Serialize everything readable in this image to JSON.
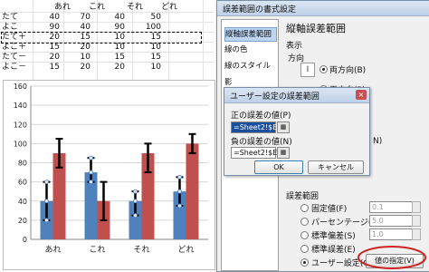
{
  "sheet": {
    "headers": [
      "あれ",
      "これ",
      "それ",
      "どれ"
    ],
    "rows": [
      {
        "label": "たて",
        "values": [
          "40",
          "70",
          "40",
          "50"
        ]
      },
      {
        "label": "よこ",
        "values": [
          "90",
          "40",
          "90",
          "100"
        ]
      },
      {
        "label": "たて＋",
        "values": [
          "20",
          "15",
          "10",
          "15"
        ]
      },
      {
        "label": "よこ＋",
        "values": [
          "15",
          "20",
          "10",
          "10"
        ]
      },
      {
        "label": "たて－",
        "values": [
          "20",
          "10",
          "15",
          "15"
        ]
      },
      {
        "label": "よこ－",
        "values": [
          "15",
          "20",
          "20",
          "10"
        ]
      }
    ]
  },
  "chart_data": {
    "type": "bar",
    "categories": [
      "あれ",
      "これ",
      "それ",
      "どれ"
    ],
    "series": [
      {
        "values": [
          40,
          70,
          40,
          50
        ],
        "err_plus": [
          20,
          15,
          10,
          15
        ],
        "err_minus": [
          20,
          10,
          15,
          15
        ],
        "color": "#4f81bd"
      },
      {
        "values": [
          90,
          40,
          90,
          100
        ],
        "err_plus": [
          15,
          20,
          10,
          10
        ],
        "err_minus": [
          15,
          20,
          20,
          10
        ],
        "color": "#c0504d"
      }
    ],
    "yticks": [
      "0",
      "20",
      "40",
      "60",
      "80",
      "100",
      "120",
      "140",
      "160"
    ],
    "ylim": [
      0,
      160
    ],
    "grid": true
  },
  "main_dialog": {
    "title": "誤差範囲の書式設定",
    "sidebar": [
      "縦軸誤差範囲",
      "線の色",
      "線のスタイル",
      "影"
    ],
    "heading": "縦軸誤差範囲",
    "display_label": "表示",
    "direction_label": "方向",
    "direction_both": "両方向(B)",
    "direction_plus": "正方向(P)",
    "direction_minus_partial": "N)",
    "error_amount_label": "誤差範囲",
    "options": [
      {
        "label": "固定値(F)",
        "value": "0.1"
      },
      {
        "label": "パーセンテージ(P)",
        "value": "5.0"
      },
      {
        "label": "標準偏差(S)",
        "value": "1.0"
      },
      {
        "label": "標準誤差(E)",
        "value": ""
      },
      {
        "label": "ユーザー設定(C)",
        "value": ""
      }
    ],
    "specify_button": "値の指定(V)"
  },
  "sub_dialog": {
    "title": "ユーザー設定の誤差範囲",
    "plus_label": "正の誤差の値(P)",
    "plus_value": "=Sheet2!$E",
    "minus_label": "負の誤差の値(N)",
    "minus_value": "=Sheet2!$E",
    "ok": "OK",
    "cancel": "キャンセル"
  },
  "colors": {
    "accent": "#c0504d",
    "selection": "#bcd5f3",
    "highlight_ellipse": "#cc2222"
  }
}
